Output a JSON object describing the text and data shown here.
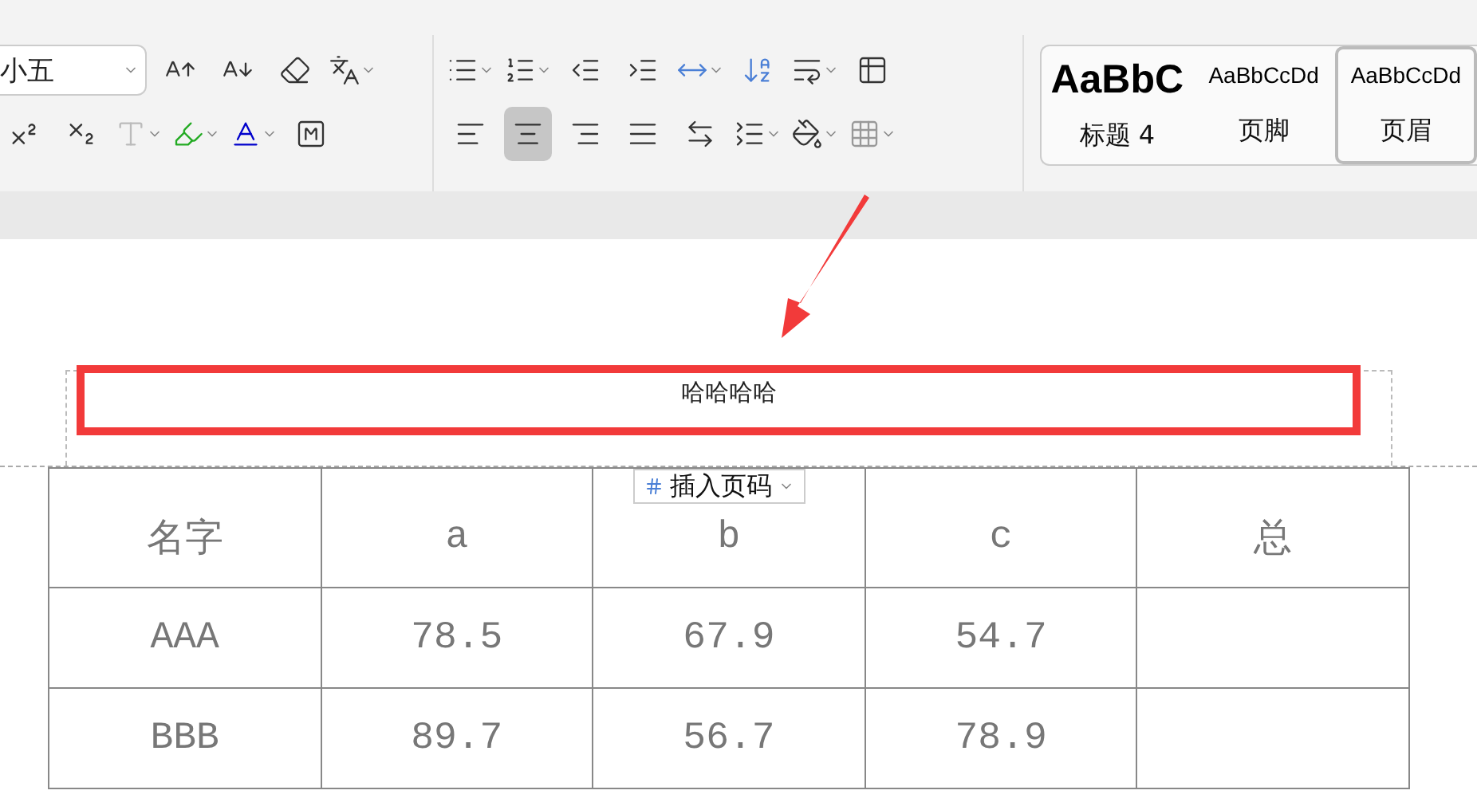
{
  "ribbon": {
    "font_size": {
      "value": "小五"
    },
    "alignment": [
      {
        "selected": false
      },
      {
        "selected": true
      },
      {
        "selected": false
      },
      {
        "selected": false
      },
      {
        "selected": false
      }
    ],
    "styles": [
      {
        "sample": "AaBbC",
        "name": "标题 4",
        "kind": "heading",
        "selected": false
      },
      {
        "sample": "AaBbCcDd",
        "name": "页脚",
        "kind": "normal",
        "selected": false
      },
      {
        "sample": "AaBbCcDd",
        "name": "页眉",
        "kind": "normal",
        "selected": true
      }
    ]
  },
  "document": {
    "header_text": "哈哈哈哈",
    "page_number_button": {
      "label": "插入页码"
    },
    "table": {
      "columns": [
        "名字",
        "a",
        "b",
        "c",
        "总"
      ],
      "rows": [
        [
          "AAA",
          "78.5",
          "67.9",
          "54.7",
          ""
        ],
        [
          "BBB",
          "89.7",
          "56.7",
          "78.9",
          ""
        ]
      ]
    }
  }
}
